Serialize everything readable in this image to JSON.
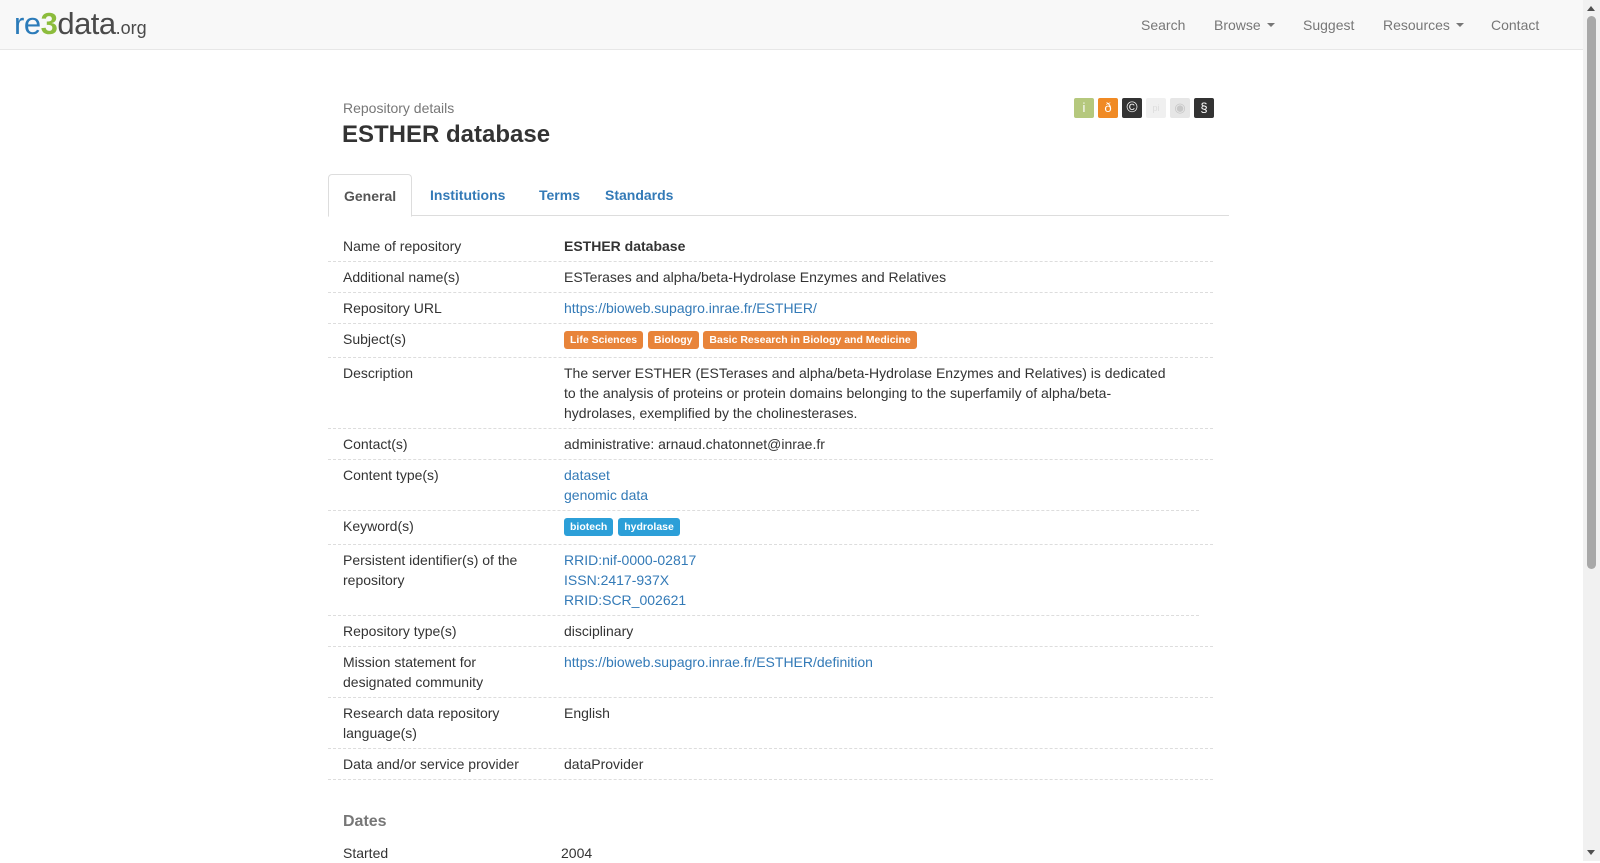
{
  "navbar": {
    "logo": {
      "re": "re",
      "three": "3",
      "data": "data",
      "org": ".org"
    },
    "search": "Search",
    "browse": "Browse",
    "suggest": "Suggest",
    "resources": "Resources",
    "contact": "Contact"
  },
  "header": {
    "subtitle": "Repository details",
    "title": "ESTHER database"
  },
  "badges": [
    {
      "name": "info",
      "glyph": "i",
      "color": "#b5c87d"
    },
    {
      "name": "open-access",
      "glyph": "ð",
      "color": "#f08a24"
    },
    {
      "name": "copyright",
      "glyph": "©",
      "color": "#333333"
    },
    {
      "name": "pid",
      "glyph": "pi",
      "color": "#f0f0f0"
    },
    {
      "name": "certificate",
      "glyph": "◉",
      "color": "#e6e6e6"
    },
    {
      "name": "policy",
      "glyph": "§",
      "color": "#333333"
    }
  ],
  "tabs": {
    "general": "General",
    "institutions": "Institutions",
    "terms": "Terms",
    "standards": "Standards"
  },
  "details": {
    "name": {
      "label": "Name of repository",
      "value": "ESTHER database"
    },
    "additional_names": {
      "label": "Additional name(s)",
      "value": "ESTerases and alpha/beta-Hydrolase Enzymes and Relatives"
    },
    "url": {
      "label": "Repository URL",
      "value": "https://bioweb.supagro.inrae.fr/ESTHER/"
    },
    "subjects": {
      "label": "Subject(s)",
      "tags": [
        "Life Sciences",
        "Biology",
        "Basic Research in Biology and Medicine"
      ]
    },
    "description": {
      "label": "Description",
      "value": "The server ESTHER (ESTerases and alpha/beta-Hydrolase Enzymes and Relatives) is dedicated to the analysis of proteins or protein domains belonging to the superfamily of alpha/beta-hydrolases, exemplified by the cholinesterases."
    },
    "contacts": {
      "label": "Contact(s)",
      "value": "administrative: arnaud.chatonnet@inrae.fr"
    },
    "content_types": {
      "label": "Content type(s)",
      "items": [
        "dataset",
        "genomic data"
      ]
    },
    "keywords": {
      "label": "Keyword(s)",
      "tags": [
        "biotech",
        "hydrolase"
      ]
    },
    "pids": {
      "label": "Persistent identifier(s) of the repository",
      "items": [
        "RRID:nif-0000-02817",
        "ISSN:2417-937X",
        "RRID:SCR_002621"
      ]
    },
    "repo_type": {
      "label": "Repository type(s)",
      "value": "disciplinary"
    },
    "mission": {
      "label": "Mission statement for designated community",
      "value": "https://bioweb.supagro.inrae.fr/ESTHER/definition"
    },
    "language": {
      "label": "Research data repository language(s)",
      "value": "English"
    },
    "provider": {
      "label": "Data and/or service provider",
      "value": "dataProvider"
    }
  },
  "dates": {
    "heading": "Dates",
    "started": {
      "label": "Started",
      "value": "2004"
    }
  }
}
